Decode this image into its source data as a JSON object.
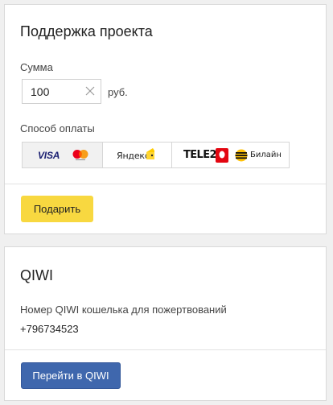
{
  "donation": {
    "title": "Поддержка проекта",
    "amount_label": "Сумма",
    "amount_value": "100",
    "currency": "руб.",
    "payment_label": "Способ оплаты",
    "payment_options": [
      {
        "id": "cards",
        "labels": [
          "VISA"
        ],
        "icons": [
          "visa-logo",
          "mastercard-logo"
        ],
        "selected": true
      },
      {
        "id": "yandex",
        "labels": [
          "Яндекс"
        ],
        "icons": [
          "yandex-money-logo",
          "yandex-wallet-icon"
        ],
        "selected": false
      },
      {
        "id": "mobile",
        "labels": [
          "TELE2",
          "Билайн"
        ],
        "icons": [
          "tele2-logo",
          "mts-logo",
          "beeline-logo"
        ],
        "selected": false
      }
    ],
    "submit_label": "Подарить",
    "accent_color": "#f8d840"
  },
  "qiwi": {
    "title": "QIWI",
    "description": "Номер QIWI кошелька для пожертвований",
    "wallet_number": "+796734523",
    "button_label": "Перейти в QIWI",
    "button_color": "#3f67ad"
  }
}
